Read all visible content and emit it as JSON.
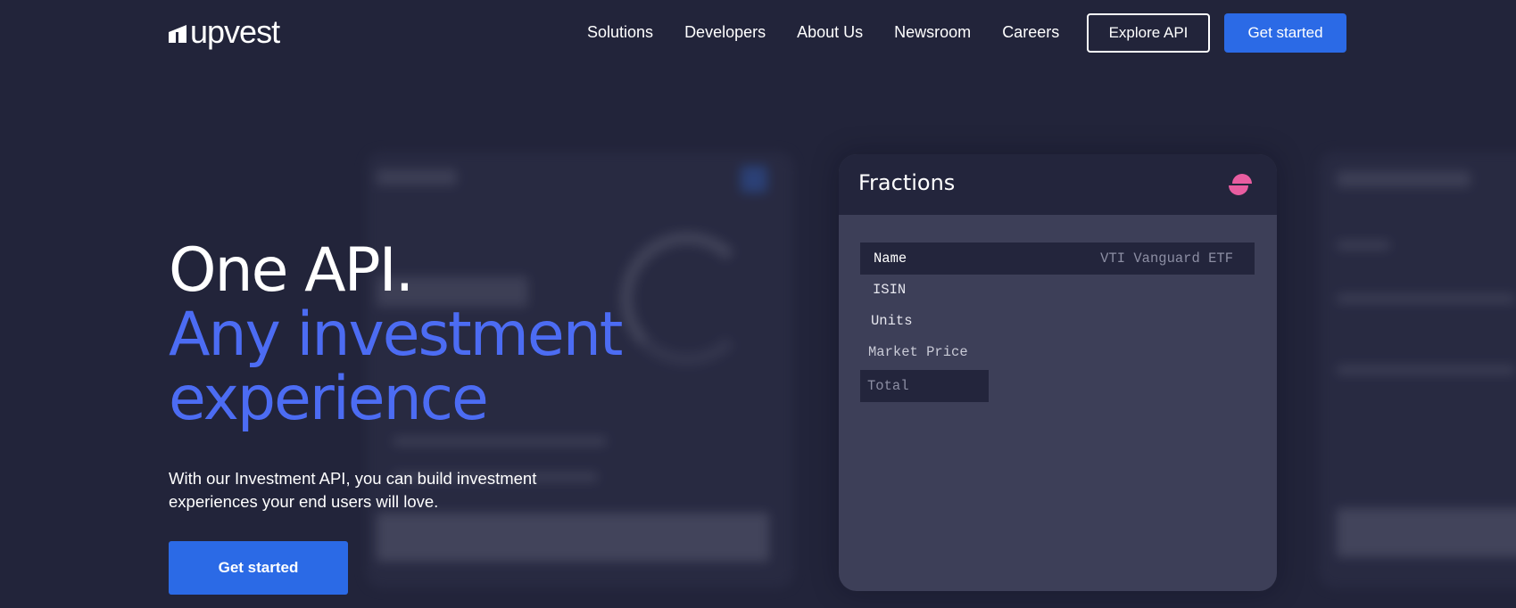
{
  "brand": {
    "name": "upvest",
    "accent": "#2b6ae6",
    "headline_blue": "#4c6cf3",
    "background": "#22243a"
  },
  "nav": {
    "links": [
      "Solutions",
      "Developers",
      "About Us",
      "Newsroom",
      "Careers"
    ],
    "explore_label": "Explore API",
    "get_started_label": "Get started"
  },
  "hero": {
    "line1": "One API.",
    "line2": "Any investment",
    "line3": "experience",
    "subtext": "With our Investment API, you can build investment experiences your end users will love.",
    "cta_label": "Get started"
  },
  "card": {
    "title": "Fractions",
    "icon": "half-circle-icon",
    "rows": {
      "name_label": "Name",
      "name_value": "VTI Vanguard ETF",
      "isin_label": "ISIN",
      "units_label": "Units",
      "market_price_label": "Market Price",
      "total_label": "Total"
    }
  }
}
